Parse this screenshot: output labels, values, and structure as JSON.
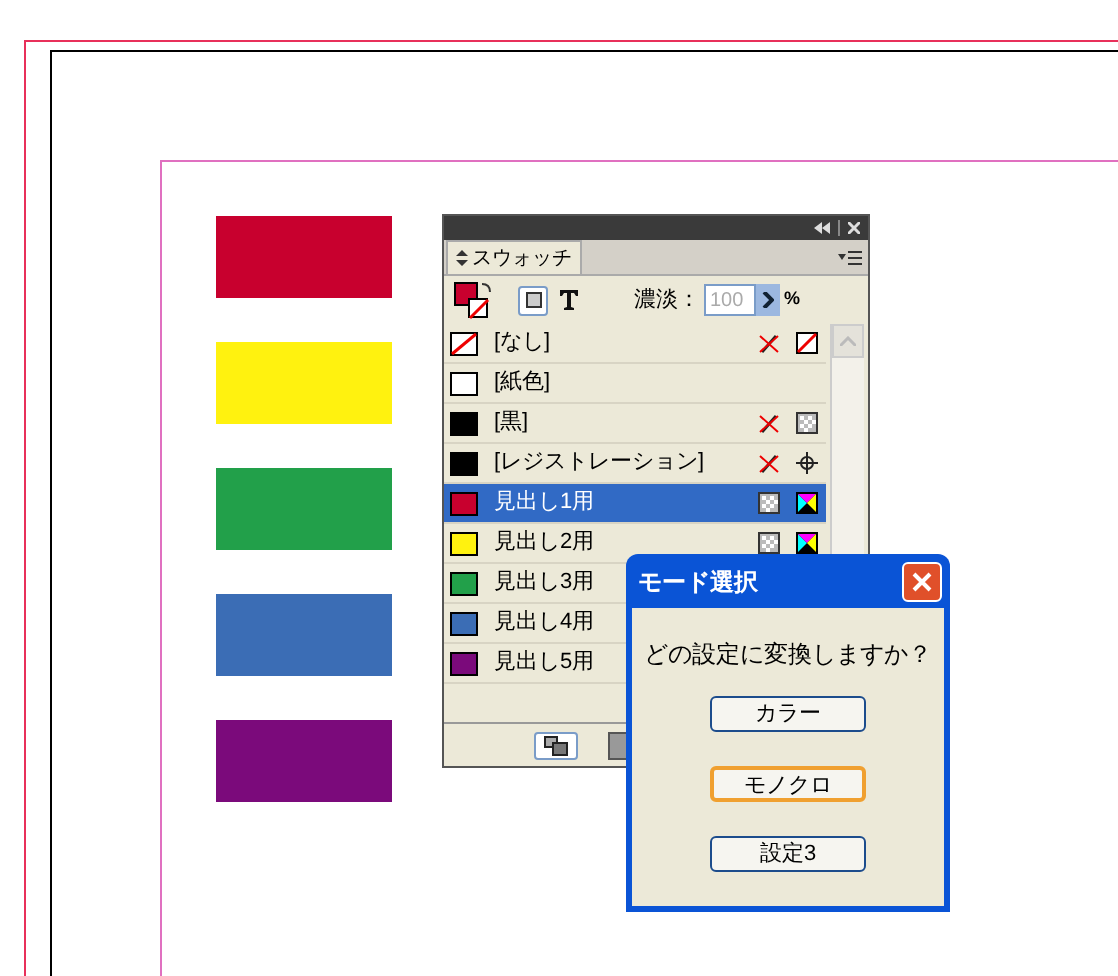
{
  "page_rects": [
    {
      "color": "#c8002e"
    },
    {
      "color": "#fff20f"
    },
    {
      "color": "#22a04a"
    },
    {
      "color": "#3b6db5"
    },
    {
      "color": "#7b0a7b"
    }
  ],
  "panel": {
    "tab": "スウォッチ",
    "tint_label": "濃淡：",
    "tint_value": "100",
    "tint_unit": "%",
    "swatches": [
      {
        "name": "[なし]",
        "kind": "none",
        "selected": false,
        "icons": [
          {
            "kind": "no-edit"
          },
          {
            "kind": "none"
          }
        ]
      },
      {
        "name": "[紙色]",
        "kind": "solid",
        "color": "#ffffff",
        "selected": false
      },
      {
        "name": "[黒]",
        "kind": "solid",
        "color": "#000000",
        "selected": false,
        "icons": [
          {
            "kind": "no-edit"
          },
          {
            "kind": "process"
          }
        ]
      },
      {
        "name": "[レジストレーション]",
        "kind": "solid",
        "color": "#000000",
        "selected": false,
        "icons": [
          {
            "kind": "no-edit"
          },
          {
            "kind": "registration"
          }
        ]
      },
      {
        "name": "見出し1用",
        "kind": "solid",
        "color": "#c8002e",
        "selected": true,
        "icons": [
          {
            "kind": "process"
          },
          {
            "kind": "cmyk"
          }
        ]
      },
      {
        "name": "見出し2用",
        "kind": "solid",
        "color": "#fff20f",
        "selected": false,
        "icons": [
          {
            "kind": "process"
          },
          {
            "kind": "cmyk"
          }
        ]
      },
      {
        "name": "見出し3用",
        "kind": "solid",
        "color": "#22a04a",
        "selected": false
      },
      {
        "name": "見出し4用",
        "kind": "solid",
        "color": "#3b6db5",
        "selected": false
      },
      {
        "name": "見出し5用",
        "kind": "solid",
        "color": "#7b0a7b",
        "selected": false
      }
    ]
  },
  "dialog": {
    "title": "モード選択",
    "message": "どの設定に変換しますか？",
    "buttons": [
      {
        "label": "カラー",
        "focused": false
      },
      {
        "label": "モノクロ",
        "focused": true
      },
      {
        "label": "設定3",
        "focused": false
      }
    ]
  }
}
